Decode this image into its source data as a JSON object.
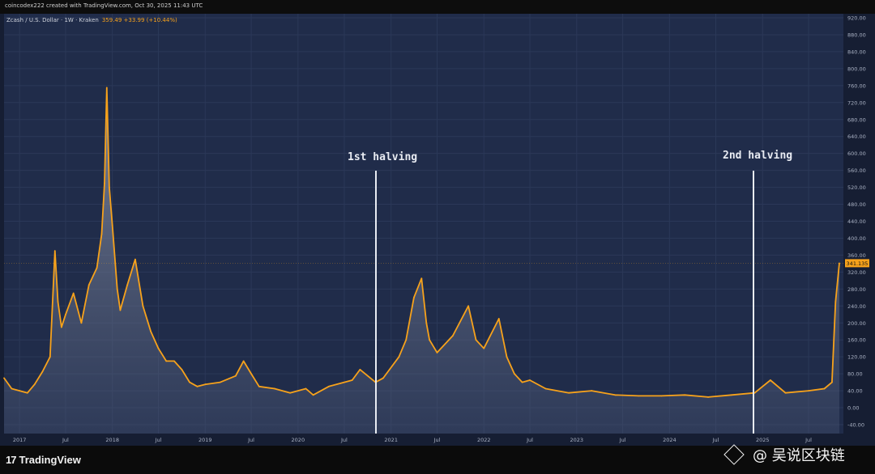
{
  "header": {
    "credit": "coincodex222 created with TradingView.com, Oct 30, 2025 11:43 UTC",
    "symbol_line": "Zcash / U.S. Dollar · 1W · Kraken",
    "price_line": "359.49  +33.99 (+10.44%)"
  },
  "annotations": {
    "first_halving": "1st halving",
    "second_halving": "2nd halving"
  },
  "footer": {
    "brand": "TradingView",
    "brand_mark": "17",
    "watermark": "@ 吴说区块链"
  },
  "colors": {
    "background": "#202c4a",
    "line": "#f7a21b",
    "grid": "#2b3858",
    "axis_panel": "#161e33"
  },
  "chart_data": {
    "type": "area",
    "title": "",
    "xlabel": "",
    "ylabel": "",
    "ylim": [
      -40,
      920
    ],
    "y_ticks": [
      "920.00",
      "880.00",
      "840.00",
      "800.00",
      "760.00",
      "720.00",
      "680.00",
      "640.00",
      "600.00",
      "560.00",
      "520.00",
      "480.00",
      "440.00",
      "400.00",
      "360.00",
      "320.00",
      "280.00",
      "240.00",
      "200.00",
      "160.00",
      "120.00",
      "80.00",
      "40.00",
      "0.00",
      "-40.00"
    ],
    "x_ticks": [
      "2017",
      "Jul",
      "2018",
      "Jul",
      "2019",
      "Jul",
      "2020",
      "Jul",
      "2021",
      "Jul",
      "2022",
      "Jul",
      "2023",
      "Jul",
      "2024",
      "Jul",
      "2025",
      "Jul"
    ],
    "last_price_label": "341.135",
    "grid": true,
    "series": [
      {
        "x": [
          "2016-11",
          "2016-12",
          "2017-01",
          "2017-02",
          "2017-03",
          "2017-04",
          "2017-05",
          "2017-05-20",
          "2017-06",
          "2017-06-15",
          "2017-07",
          "2017-08",
          "2017-09",
          "2017-10",
          "2017-11",
          "2017-11-20",
          "2017-12",
          "2017-12-10",
          "2017-12-20",
          "2018-01",
          "2018-01-20",
          "2018-02",
          "2018-03",
          "2018-04",
          "2018-05",
          "2018-06",
          "2018-07",
          "2018-08",
          "2018-09",
          "2018-10",
          "2018-11",
          "2018-12",
          "2019-01",
          "2019-03",
          "2019-05",
          "2019-06",
          "2019-07",
          "2019-08",
          "2019-10",
          "2019-12",
          "2020-02",
          "2020-03",
          "2020-05",
          "2020-08",
          "2020-09",
          "2020-11",
          "2020-12",
          "2021-02",
          "2021-03",
          "2021-04",
          "2021-05",
          "2021-05-20",
          "2021-06",
          "2021-07",
          "2021-09",
          "2021-11",
          "2021-12",
          "2022-01",
          "2022-03",
          "2022-04",
          "2022-05",
          "2022-06",
          "2022-07",
          "2022-09",
          "2022-12",
          "2023-03",
          "2023-06",
          "2023-09",
          "2023-12",
          "2024-03",
          "2024-06",
          "2024-09",
          "2024-12",
          "2025-02",
          "2025-04",
          "2025-07",
          "2025-09",
          "2025-10",
          "2025-10-15",
          "2025-10-30"
        ],
        "y": [
          70,
          45,
          40,
          35,
          55,
          85,
          120,
          370,
          250,
          190,
          220,
          270,
          200,
          290,
          330,
          410,
          530,
          755,
          520,
          430,
          280,
          230,
          290,
          350,
          240,
          180,
          140,
          110,
          110,
          90,
          60,
          50,
          55,
          60,
          75,
          110,
          80,
          50,
          45,
          35,
          45,
          30,
          50,
          65,
          90,
          60,
          70,
          120,
          160,
          260,
          305,
          200,
          160,
          130,
          170,
          240,
          160,
          140,
          210,
          120,
          80,
          60,
          65,
          45,
          35,
          40,
          30,
          28,
          28,
          30,
          25,
          30,
          35,
          65,
          35,
          40,
          45,
          60,
          250,
          341
        ]
      }
    ]
  }
}
